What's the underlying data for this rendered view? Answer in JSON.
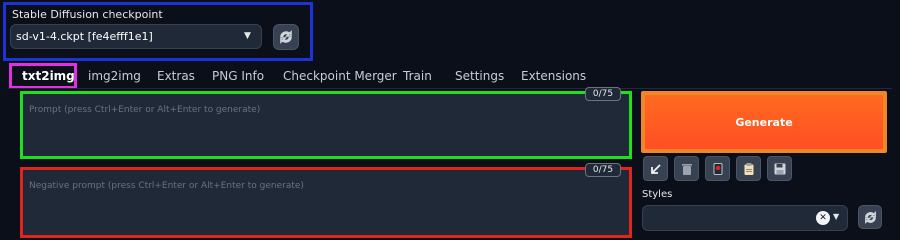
{
  "checkpoint": {
    "label": "Stable Diffusion checkpoint",
    "value": "sd-v1-4.ckpt [fe4efff1e1]",
    "dropdown_icon": "caret-down-icon",
    "refresh_icon": "refresh-icon"
  },
  "tabs": [
    {
      "label": "txt2img",
      "active": true
    },
    {
      "label": "img2img"
    },
    {
      "label": "Extras"
    },
    {
      "label": "PNG Info"
    },
    {
      "label": "Checkpoint Merger"
    },
    {
      "label": "Train"
    },
    {
      "label": "Settings"
    },
    {
      "label": "Extensions"
    }
  ],
  "prompt": {
    "placeholder": "Prompt (press Ctrl+Enter or Alt+Enter to generate)",
    "counter": "0/75"
  },
  "negative_prompt": {
    "placeholder": "Negative prompt (press Ctrl+Enter or Alt+Enter to generate)",
    "counter": "0/75"
  },
  "generate": {
    "label": "Generate"
  },
  "tools": [
    {
      "icon": "arrow-down-left-icon"
    },
    {
      "icon": "trash-icon"
    },
    {
      "icon": "red-card-icon"
    },
    {
      "icon": "clipboard-icon"
    },
    {
      "icon": "save-icon"
    }
  ],
  "styles": {
    "label": "Styles",
    "clear_icon": "close-icon",
    "dropdown_icon": "caret-down-icon",
    "refresh_icon": "refresh-icon"
  },
  "colors": {
    "background": "#0b0f19",
    "generate": "#ff5a23",
    "highlight_blue": "#1d33d8",
    "highlight_magenta": "#e22fe0",
    "highlight_green": "#1fe01f",
    "highlight_red": "#e0261c"
  }
}
